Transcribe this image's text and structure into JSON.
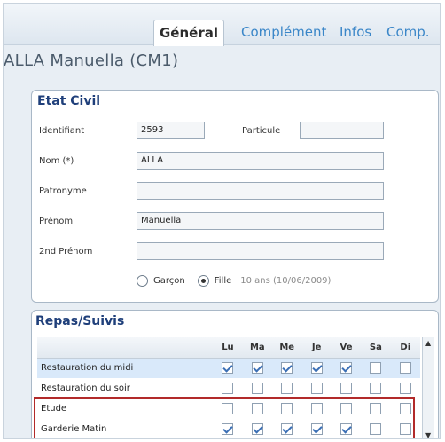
{
  "tabs": [
    {
      "label": "Général",
      "active": true
    },
    {
      "label": "Complément",
      "active": false
    },
    {
      "label": "Infos",
      "active": false
    },
    {
      "label": "Comp.",
      "active": false
    }
  ],
  "student_title": "ALLA Manuella (CM1)",
  "etat_civil": {
    "title": "Etat Civil",
    "identifiant_label": "Identifiant",
    "identifiant_value": "2593",
    "particule_label": "Particule",
    "particule_value": "",
    "nom_label": "Nom (*)",
    "nom_value": "ALLA",
    "patronyme_label": "Patronyme",
    "patronyme_value": "",
    "prenom_label": "Prénom",
    "prenom_value": "Manuella",
    "prenom2_label": "2nd Prénom",
    "prenom2_value": "",
    "gender_garcon": "Garçon",
    "gender_fille": "Fille",
    "gender_selected": "Fille",
    "age_text": "10 ans (10/06/2009)"
  },
  "repas": {
    "title": "Repas/Suivis",
    "days": [
      "Lu",
      "Ma",
      "Me",
      "Je",
      "Ve",
      "Sa",
      "Di"
    ],
    "rows": [
      {
        "name": "Restauration du midi",
        "checks": [
          true,
          true,
          true,
          true,
          true,
          false,
          false
        ],
        "selected": true
      },
      {
        "name": "Restauration du soir",
        "checks": [
          false,
          false,
          false,
          false,
          false,
          false,
          false
        ],
        "selected": false
      },
      {
        "name": "Etude",
        "checks": [
          false,
          false,
          false,
          false,
          false,
          false,
          false
        ],
        "selected": false
      },
      {
        "name": "Garderie Matin",
        "checks": [
          true,
          true,
          true,
          true,
          true,
          false,
          false
        ],
        "selected": false
      }
    ]
  },
  "colors": {
    "accent_blue": "#3a86c8",
    "title_blue": "#1f3f7a",
    "highlight_red": "#b22a2a"
  }
}
